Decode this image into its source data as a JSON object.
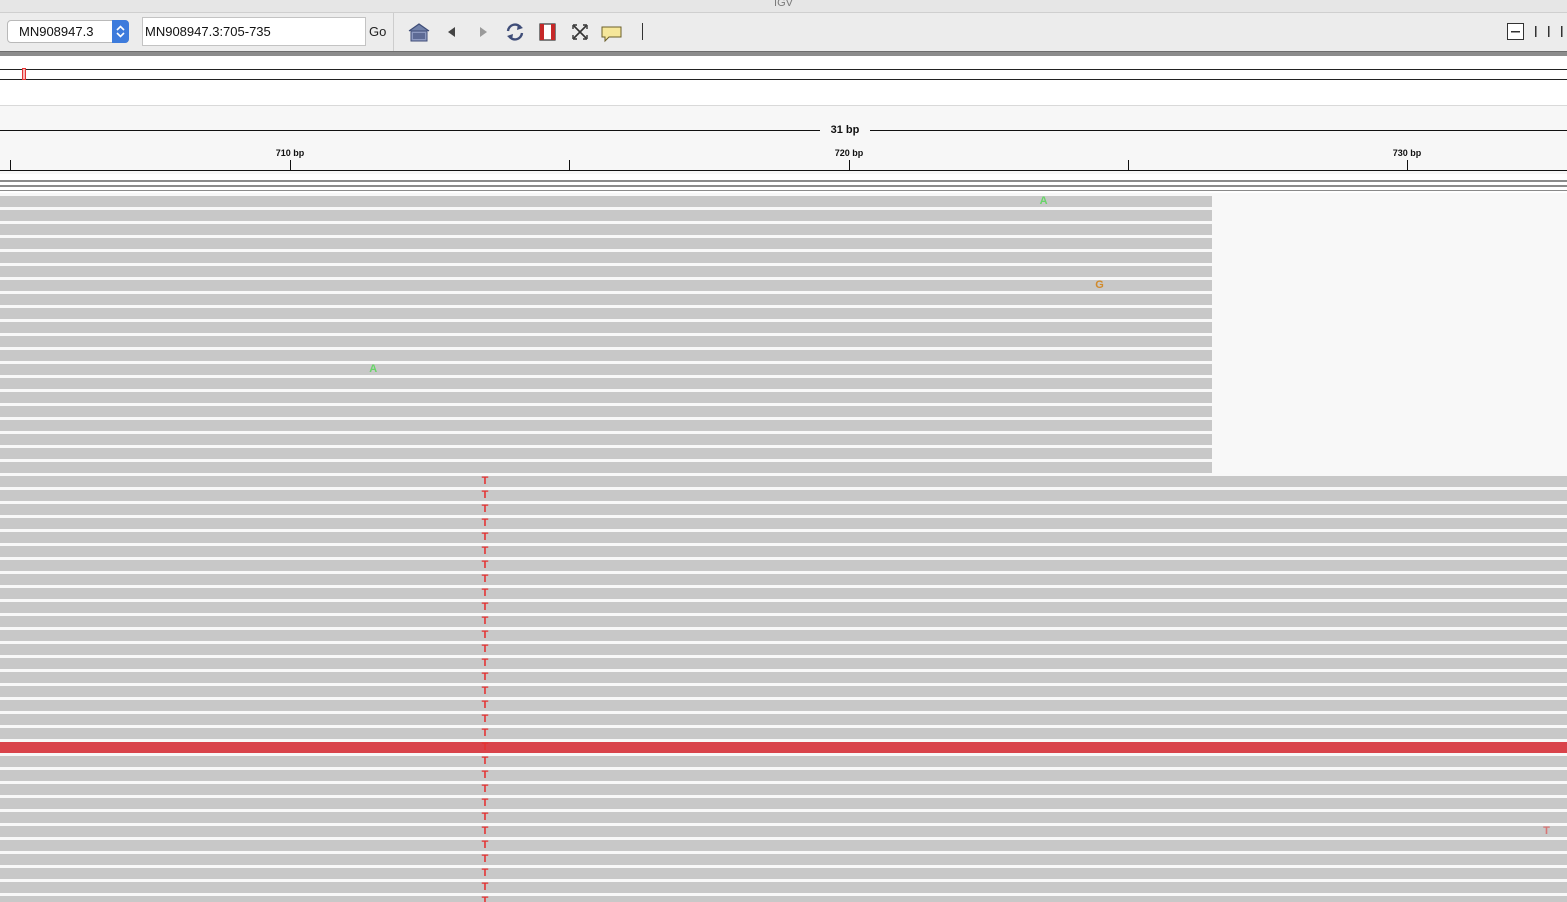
{
  "window": {
    "title": "IGV"
  },
  "toolbar": {
    "chromosome": "MN908947.3",
    "locus": "MN908947.3:705-735",
    "go_label": "Go",
    "icons": [
      "home-icon",
      "back-arrow-icon",
      "forward-arrow-icon",
      "refresh-icon",
      "region-of-interest-icon",
      "fit-to-window-icon",
      "popup-info-icon"
    ],
    "window_controls": [
      "minimize-icon",
      "resize-handle-icon"
    ]
  },
  "ruler": {
    "span_label": "31 bp",
    "tick_labels": [
      "710 bp",
      "720 bp",
      "730 bp"
    ]
  },
  "alignments": {
    "upper_block_reads": 20,
    "lower_block_reads": 31,
    "mismatches": [
      {
        "base": "A",
        "row": 0,
        "position": 723
      },
      {
        "base": "G",
        "row": 6,
        "position": 724
      },
      {
        "base": "A",
        "row": 12,
        "position": 711
      },
      {
        "base": "T",
        "row": "20-50",
        "position": 713
      },
      {
        "base": "T",
        "row": 45,
        "position": 732
      }
    ],
    "highlighted_read_row": 39
  },
  "colors": {
    "read": "#c8c8c8",
    "highlight_read": "#d9434a",
    "base_T": "#e53333",
    "base_A": "#68d468",
    "base_G": "#d08a2c",
    "accent": "#3d7bdc"
  }
}
